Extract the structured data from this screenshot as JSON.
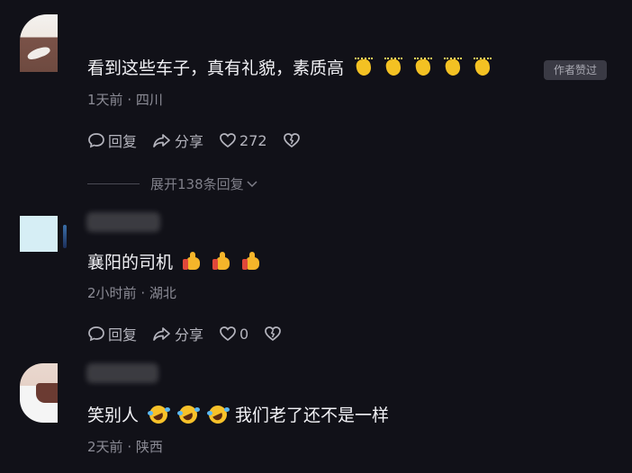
{
  "comments": [
    {
      "text": "看到这些车子，真有礼貌，素质高",
      "emojis": [
        "clap-emoji",
        "clap-emoji",
        "clap-emoji",
        "clap-emoji",
        "clap-emoji"
      ],
      "badge": "作者赞过",
      "time": "1天前",
      "location": "四川",
      "reply_label": "回复",
      "share_label": "分享",
      "likes": "272",
      "replies_expand": "展开138条回复"
    },
    {
      "text": "襄阳的司机",
      "emojis": [
        "thumbs-up-emoji",
        "thumbs-up-emoji",
        "thumbs-up-emoji"
      ],
      "time": "2小时前",
      "location": "湖北",
      "reply_label": "回复",
      "share_label": "分享",
      "likes": "0"
    },
    {
      "text_before": "笑别人",
      "emojis": [
        "laughing-tears-emoji",
        "laughing-tears-emoji",
        "laughing-tears-emoji"
      ],
      "text_after": "我们老了还不是一样",
      "time": "2天前",
      "location": "陕西"
    }
  ],
  "separator": "·",
  "colors": {
    "background": "#111118",
    "primary_text": "#f1f1f5",
    "secondary_text": "#8c8c96",
    "action_text": "#b4b4bd",
    "badge_bg": "#3a3a44"
  }
}
